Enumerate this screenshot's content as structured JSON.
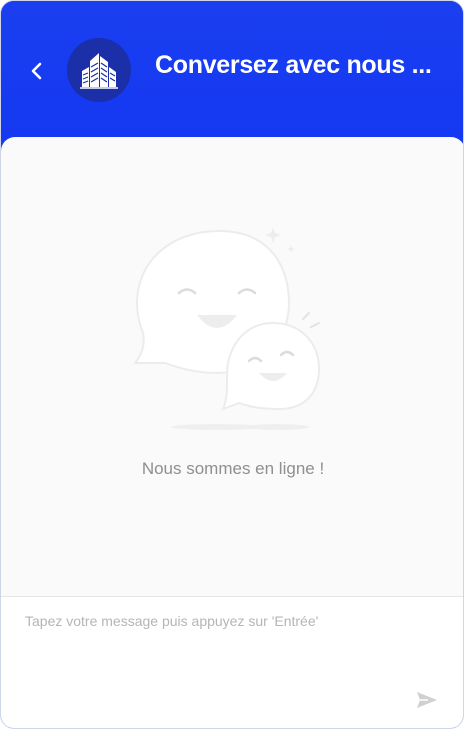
{
  "header": {
    "title": "Conversez avec nous ...",
    "back_icon": "chevron-left-icon",
    "logo_icon": "buildings-logo-icon",
    "color": "#1538f2"
  },
  "main": {
    "illustration_icon": "chat-bubbles-illustration",
    "status_text": "Nous sommes en ligne !"
  },
  "composer": {
    "placeholder": "Tapez votre message puis appuyez sur 'Entrée'",
    "send_icon": "send-icon"
  }
}
